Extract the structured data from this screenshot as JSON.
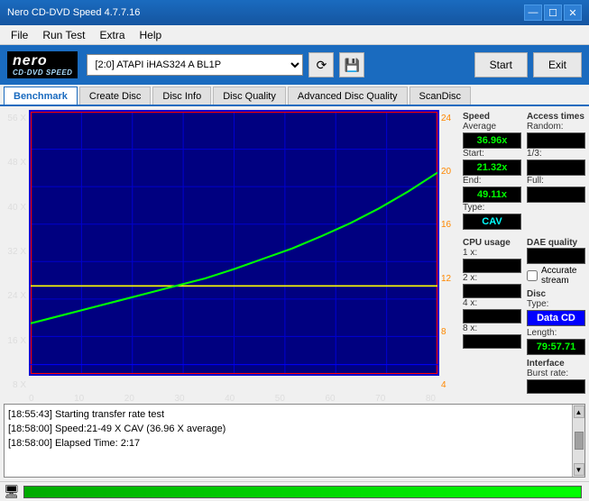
{
  "titlebar": {
    "title": "Nero CD-DVD Speed 4.7.7.16",
    "controls": [
      "—",
      "☐",
      "✕"
    ]
  },
  "menubar": {
    "items": [
      "File",
      "Run Test",
      "Extra",
      "Help"
    ]
  },
  "toolbar": {
    "logo_line1": "nero",
    "logo_line2": "CD·DVD SPEED",
    "drive_label": "[2:0]  ATAPI iHAS324  A BL1P",
    "start_label": "Start",
    "exit_label": "Exit"
  },
  "tabs": {
    "items": [
      "Benchmark",
      "Create Disc",
      "Disc Info",
      "Disc Quality",
      "Advanced Disc Quality",
      "ScanDisc"
    ],
    "active": "Benchmark"
  },
  "chart": {
    "y_left_labels": [
      "56 X",
      "48 X",
      "40 X",
      "32 X",
      "24 X",
      "16 X",
      "8 X"
    ],
    "y_right_labels": [
      "24",
      "20",
      "16",
      "12",
      "8",
      "4"
    ],
    "x_labels": [
      "0",
      "10",
      "20",
      "30",
      "40",
      "50",
      "60",
      "70",
      "80"
    ]
  },
  "speed": {
    "section_title": "Speed",
    "average_label": "Average",
    "average_value": "36.96x",
    "start_label": "Start:",
    "start_value": "21.32x",
    "end_label": "End:",
    "end_value": "49.11x",
    "type_label": "Type:",
    "type_value": "CAV"
  },
  "access_times": {
    "section_title": "Access times",
    "random_label": "Random:",
    "random_value": "",
    "one_third_label": "1/3:",
    "one_third_value": "",
    "full_label": "Full:",
    "full_value": ""
  },
  "cpu_usage": {
    "section_title": "CPU usage",
    "val1x_label": "1 x:",
    "val1x_value": "",
    "val2x_label": "2 x:",
    "val2x_value": "",
    "val4x_label": "4 x:",
    "val4x_value": "",
    "val8x_label": "8 x:",
    "val8x_value": ""
  },
  "dae": {
    "section_title": "DAE quality",
    "value": ""
  },
  "accurate_stream": {
    "label": "Accurate stream",
    "checked": false
  },
  "disc": {
    "section_title": "Disc",
    "type_label": "Type:",
    "type_value": "Data CD",
    "length_label": "Length:",
    "length_value": "79:57.71"
  },
  "interface": {
    "section_title": "Interface",
    "burst_rate_label": "Burst rate:",
    "burst_rate_value": ""
  },
  "log": {
    "lines": [
      "[18:55:43]  Starting transfer rate test",
      "[18:58:00]  Speed:21-49 X CAV (36.96 X average)",
      "[18:58:00]  Elapsed Time: 2:17"
    ]
  },
  "statusbar": {
    "progress": 100
  }
}
